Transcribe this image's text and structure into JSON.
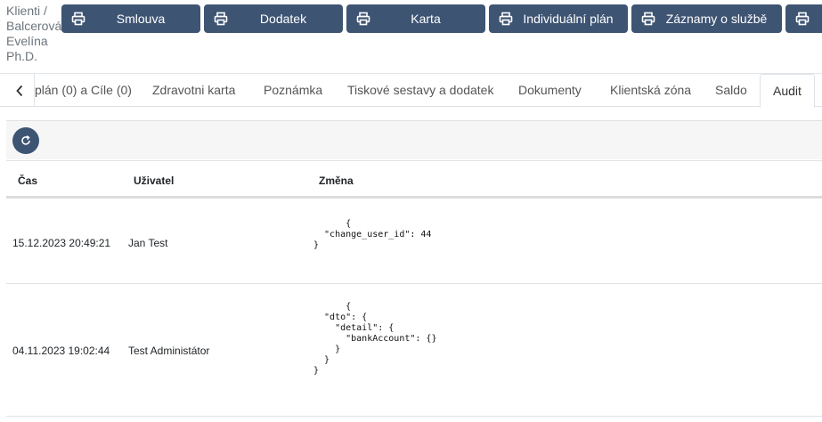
{
  "breadcrumb": {
    "lines": [
      "Klienti /",
      "Balcerová",
      "Evelína",
      "Ph.D."
    ]
  },
  "toolbar": {
    "buttons": [
      {
        "label": "Smlouva"
      },
      {
        "label": "Dodatek"
      },
      {
        "label": "Karta"
      },
      {
        "label": "Individuální plán"
      },
      {
        "label": "Záznamy o službě"
      },
      {
        "label": ""
      }
    ]
  },
  "tabs": [
    {
      "label": "plán (0) a Cíle (0)"
    },
    {
      "label": "Zdravotni karta"
    },
    {
      "label": "Poznámka"
    },
    {
      "label": "Tiskové sestavy a dodatek"
    },
    {
      "label": "Dokumenty"
    },
    {
      "label": "Klientská zóna"
    },
    {
      "label": "Saldo"
    },
    {
      "label": "Audit",
      "active": true
    }
  ],
  "table": {
    "columns": [
      "Čas",
      "Uživatel",
      "Změna"
    ],
    "rows": [
      {
        "time": "15.12.2023 20:49:21",
        "user": "Jan Test",
        "change": "      {\n  \"change_user_id\": 44\n}"
      },
      {
        "time": "04.11.2023 19:02:44",
        "user": "Test Administátor",
        "change": "      {\n  \"dto\": {\n    \"detail\": {\n      \"bankAccount\": {}\n    }\n  }\n}"
      }
    ]
  },
  "colors": {
    "primary": "#3e5473",
    "border": "#dee2e6",
    "muted": "#6c757d"
  },
  "icons": {
    "button_icon": "printer-icon",
    "nav_prev": "chevron-left-icon",
    "refresh": "refresh-icon"
  }
}
